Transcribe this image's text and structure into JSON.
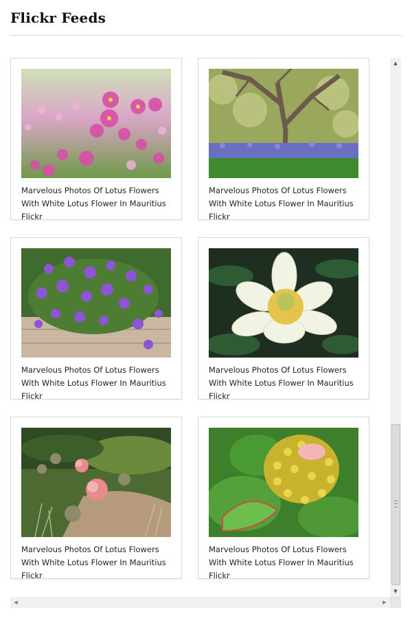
{
  "widget": {
    "title": "Flickr Feeds"
  },
  "cards": [
    {
      "caption": "Marvelous Photos Of Lotus Flowers With White Lotus Flower In Mauritius Flickr",
      "image": "pink-cosmos-flowers-photo"
    },
    {
      "caption": "Marvelous Photos Of Lotus Flowers With White Lotus Flower In Mauritius Flickr",
      "image": "tree-bluebells-photo"
    },
    {
      "caption": "Marvelous Photos Of Lotus Flowers With White Lotus Flower In Mauritius Flickr",
      "image": "purple-flower-bush-photo"
    },
    {
      "caption": "Marvelous Photos Of Lotus Flowers With White Lotus Flower In Mauritius Flickr",
      "image": "white-lotus-photo"
    },
    {
      "caption": "Marvelous Photos Of Lotus Flowers With White Lotus Flower In Mauritius Flickr",
      "image": "pink-lotus-garden-photo"
    },
    {
      "caption": "Marvelous Photos Of Lotus Flowers With White Lotus Flower In Mauritius Flickr",
      "image": "yellow-protea-photo"
    }
  ],
  "scrollbars": {
    "vertical": {
      "up_icon": "arrow-up-icon",
      "down_icon": "arrow-down-icon",
      "position": 0.92
    },
    "horizontal": {
      "left_icon": "arrow-left-icon",
      "right_icon": "arrow-right-icon"
    }
  }
}
